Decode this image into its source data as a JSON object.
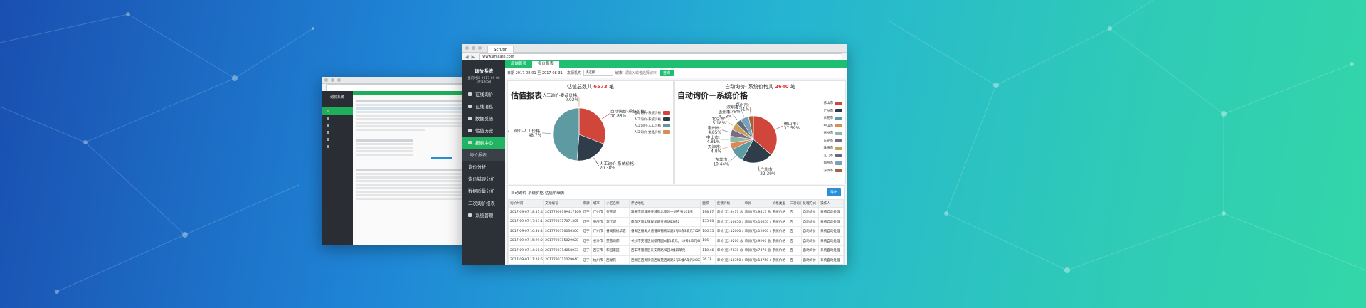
{
  "colors": {
    "accent_green": "#1fbf71",
    "sidebar_dark": "#2c3138",
    "highlight_red": "#e3342f",
    "export_blue": "#2a8fd6"
  },
  "front": {
    "browser_tab": "Scrutin",
    "url": "www.amcato.com",
    "brand": "询价系统",
    "account": "当前时间 2017-09-06 09:16:58",
    "sidebar": [
      {
        "label": "在线询价",
        "type": "item"
      },
      {
        "label": "在线消息",
        "type": "item"
      },
      {
        "label": "数据反馈",
        "type": "item"
      },
      {
        "label": "估值历史",
        "type": "item"
      },
      {
        "label": "报表中心",
        "type": "active"
      },
      {
        "label": "询价报表",
        "type": "sub"
      },
      {
        "label": "询价分析",
        "type": "item2"
      },
      {
        "label": "询价错误分析",
        "type": "item2"
      },
      {
        "label": "数据质量分析",
        "type": "item2"
      },
      {
        "label": "二次询价报表",
        "type": "item2"
      },
      {
        "label": "系统管理",
        "type": "item"
      }
    ],
    "tabs": [
      "后端首页",
      "报价报表"
    ],
    "filter": {
      "date_range": "日期 2017-08-01 至 2017-08-31",
      "source_label": "来源机构",
      "source_value": "请选择",
      "city_label": "城市",
      "city_placeholder": "请输入或者选择城市",
      "query": "查询"
    },
    "left_panel": {
      "title_prefix": "估值总数共",
      "count": "6573",
      "title_suffix": "笔",
      "heading": "估值报表"
    },
    "right_panel": {
      "title_prefix": "自动询价- 系统价格共",
      "count": "2640",
      "title_suffix": "笔",
      "heading": "自动询价－系统价格"
    },
    "table": {
      "title": "自动询价-系统价格-估值明细表",
      "export": "导出",
      "headers": [
        "询价时间",
        "交易编号",
        "来源",
        "城市",
        "小区名称",
        "评估地址",
        "面积",
        "反馈价格",
        "单价",
        "价格类型",
        "二次询价",
        "处理方式",
        "操作人"
      ],
      "rows": [
        [
          "2017-09-07 18:51:45",
          "2017790019A417169",
          "辽宁",
          "广州市",
          "天宝城",
          "珠海市新城海天城街北面领一组户号101房",
          "198.87",
          "单价(元):9417 总价(万):1871.99",
          "单价(元):9417 总价(万):1871.99",
          "系统价格",
          "否",
          "自动询价",
          "系统自动处理"
        ],
        [
          "2017-09-07 17:07:12",
          "2017790717071305",
          "辽宁",
          "重庆市",
          "现代城",
          "南岸区南山镇观星路五组1号3栋2",
          "133.00",
          "单价(元):10650 总价(万):141.65",
          "单价(元):10650 总价(万):141.65",
          "系统价格",
          "否",
          "自动询价",
          "系统自动处理"
        ],
        [
          "2017-09-07 16:36:26",
          "2017790716036306",
          "辽宁",
          "广州市",
          "番禺锦绣华庭",
          "番禺区番禺大道番禺锦绣华庭1号4栋3单元702号",
          "106.55",
          "单价(元):12000 总价(万):127.87",
          "单价(元):12000 总价(万):127.87",
          "系统价格",
          "否",
          "自动询价",
          "系统自动处理"
        ],
        [
          "2017-09-07 15:29:27",
          "2017790715029020",
          "辽宁",
          "长沙市",
          "芙蓉尚都",
          "长沙市芙蓉区尚都花园A座1单元，18号1单元401",
          "106",
          "单价(元):9200 总价(万):97.52",
          "单价(元):9200 总价(万):97.52",
          "系统价格",
          "否",
          "自动询价",
          "系统自动处理"
        ],
        [
          "2017-09-07 14:58:37",
          "2017790714058033",
          "辽宁",
          "西安市",
          "和园家园",
          "西安市雁塔区长安南路和园4幢四单元",
          "118.46",
          "单价(元):7870 总价(万):93.18",
          "单价(元):7870 总价(万):93.18",
          "系统价格",
          "否",
          "自动询价",
          "系统自动处理"
        ],
        [
          "2017-09-07 11:29:55",
          "2017790711029040",
          "辽宁",
          "杭州市",
          "西湖苑",
          "西湖区西湖街道西湖苑西湖路5号5幢A单元2003室",
          "76.78",
          "单价(元):18750 总价(万):143.96",
          "单价(元):18750 总价(万):143.96",
          "系统价格",
          "否",
          "自动询价",
          "系统自动处理"
        ],
        [
          "2017-09-07 11:20:01",
          "2017790711020047",
          "辽宁",
          "南京市",
          "金陵世纪花园",
          "建邺区兴隆街道金陵世纪花园5栋301室",
          "87.75",
          "单价(元):19252 总价(万):168.93",
          "单价(元):19252 总价(万):168.93",
          "系统价格",
          "否",
          "自动询价",
          "系统自动处理"
        ],
        [
          "2017-09-07 10:03:41",
          "2017790710003041",
          "辽宁",
          "苏州市",
          "苏州花园",
          "苏州市姑苏区苏州花园7幢604室",
          "96.20",
          "单价(元):16930 总价(万):162.87",
          "单价(元):16930 总价(万):162.87",
          "系统价格",
          "否",
          "自动询价",
          "系统自动处理"
        ]
      ]
    }
  },
  "chart_data": [
    {
      "type": "pie",
      "title": "估值报表",
      "series": [
        {
          "name": "自动询价-系统价格",
          "value": 30.88,
          "label": "自动询价-系统价格:\n30.88%",
          "color": "#d0463a"
        },
        {
          "name": "人工询价-系统价格",
          "value": 20.38,
          "label": "人工询价-系统价格:\n20.38%",
          "color": "#2f3d4a"
        },
        {
          "name": "人工询价-人工价格",
          "value": 48.7,
          "label": "人工询价-人工价格:\n48.7%",
          "color": "#5e9aa2"
        },
        {
          "name": "人工询价-委品价格",
          "value": 0.02,
          "label": "人工询价-委品价格:\n0.02%",
          "color": "#d98a56"
        }
      ]
    },
    {
      "type": "pie",
      "title": "自动询价－系统价格",
      "series": [
        {
          "name": "佛山市",
          "value": 37.59,
          "label": "佛山市:\n37.59%",
          "color": "#d0463a"
        },
        {
          "name": "广州市",
          "value": 22.39,
          "label": "广州市:\n22.39%",
          "color": "#2f3d4a"
        },
        {
          "name": "东莞市",
          "value": 10.44,
          "label": "东莞市:\n10.44%",
          "color": "#5e9aa2"
        },
        {
          "name": "中山市",
          "value": 4.8,
          "label": "天津市:\n4.8%",
          "color": "#d98a56"
        },
        {
          "name": "惠州市",
          "value": 4.81,
          "label": "中山市:\n4.81%",
          "color": "#8fb8a0"
        },
        {
          "name": "珠海市",
          "value": 4.85,
          "label": "惠州市:\n4.85%",
          "color": "#7c6a8c"
        },
        {
          "name": "江门市",
          "value": 5.18,
          "label": "北京市:\n5.18%",
          "color": "#c6a15b"
        },
        {
          "name": "深圳市",
          "value": 4.18,
          "label": "惠州市:\n4.18%",
          "color": "#5f6e79"
        },
        {
          "name": "肇庆市",
          "value": 5.79,
          "label": "深圳市:\n5.79%",
          "color": "#7aa0b8"
        },
        {
          "name": "郑州市",
          "value": 3.51,
          "label": "郑州市:\n3.51%",
          "color": "#a0643e"
        }
      ],
      "legend": [
        "佛山市",
        "广州市",
        "东莞市",
        "中山市",
        "惠州市",
        "东莞市",
        "珠海市",
        "江门市",
        "郑州市",
        "深圳市"
      ]
    }
  ]
}
